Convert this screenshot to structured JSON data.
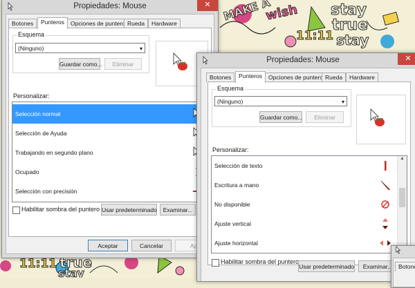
{
  "wallpaper": {
    "words": [
      "MAKE A",
      "wish",
      "stay",
      "true",
      "stay",
      "11:11",
      "11:11",
      "true",
      "stay"
    ]
  },
  "window_back": {
    "title": "Propiedades: Mouse",
    "close_label": "✕",
    "tabs": [
      "Botones",
      "Punteros",
      "Opciones de puntero",
      "Rueda",
      "Hardware"
    ],
    "scheme_label": "Esquema",
    "scheme_value": "(Ninguno)",
    "save_as_label": "Guardar como...",
    "delete_label": "Eliminar",
    "customize_label": "Personalizar:",
    "items": [
      {
        "label": "Selección normal",
        "icon": "arrow-cursor-icon"
      },
      {
        "label": "Selección de Ayuda",
        "icon": "help-cursor-icon"
      },
      {
        "label": "Trabajando en segundo plano",
        "icon": "working-cursor-icon"
      },
      {
        "label": "Ocupado",
        "icon": "busy-cursor-icon"
      },
      {
        "label": "Selección con precisión",
        "icon": "precision-cursor-icon"
      }
    ],
    "shadow_label": "Habilitar sombra del puntero",
    "default_label": "Usar predeterminado",
    "browse_label": "Examinar...",
    "ok_label": "Aceptar",
    "cancel_label": "Cancelar",
    "apply_label": "Apli"
  },
  "window_front": {
    "title": "Propiedades: Mouse",
    "close_label": "✕",
    "tabs": [
      "Botones",
      "Punteros",
      "Opciones de puntero",
      "Rueda",
      "Hardware"
    ],
    "scheme_label": "Esquema",
    "scheme_value": "(Ninguno)",
    "save_as_label": "Guardar como...",
    "delete_label": "Eliminar",
    "customize_label": "Personalizar:",
    "items": [
      {
        "label": "Selección de texto",
        "icon": "text-cursor-icon"
      },
      {
        "label": "Escritura a mano",
        "icon": "handwriting-cursor-icon"
      },
      {
        "label": "No disponible",
        "icon": "unavailable-cursor-icon"
      },
      {
        "label": "Ajuste vertical",
        "icon": "vertical-resize-icon"
      },
      {
        "label": "Ajuste horizontal",
        "icon": "horizontal-resize-icon"
      }
    ],
    "shadow_label": "Habilitar sombra del puntero",
    "default_label": "Usar predeterminado",
    "browse_label": "Examinar..."
  },
  "window_third": {
    "tab_label": "Botone"
  },
  "colors": {
    "selection": "#3399ff",
    "close_button": "#c9463d",
    "strawberry": "#d8312a"
  }
}
